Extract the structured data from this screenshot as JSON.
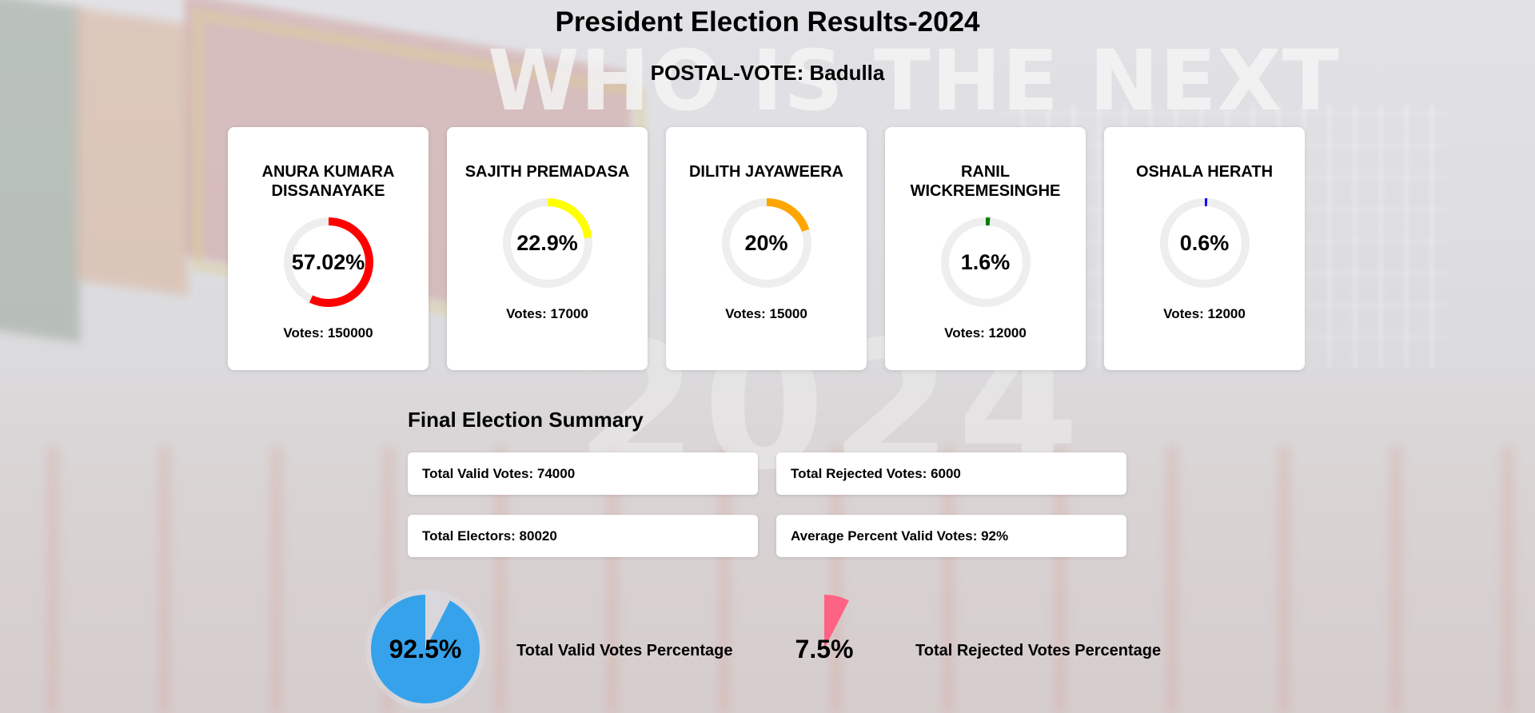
{
  "page": {
    "title": "President Election Results-2024",
    "subtitle": "POSTAL-VOTE: Badulla",
    "background_text": "WHO IS THE NEXT",
    "background_year": "2024"
  },
  "candidates": [
    {
      "name": "ANURA KUMARA DISSANAYAKE",
      "percent_label": "57.02%",
      "percent": 57.02,
      "votes_label": "Votes: 150000",
      "color": "#ff0000"
    },
    {
      "name": "SAJITH PREMADASA",
      "percent_label": "22.9%",
      "percent": 22.9,
      "votes_label": "Votes: 17000",
      "color": "#ffff00"
    },
    {
      "name": "DILITH JAYAWEERA",
      "percent_label": "20%",
      "percent": 20,
      "votes_label": "Votes: 15000",
      "color": "#ffa500"
    },
    {
      "name": "RANIL WICKREMESINGHE",
      "percent_label": "1.6%",
      "percent": 1.6,
      "votes_label": "Votes: 12000",
      "color": "#008000"
    },
    {
      "name": "OSHALA HERATH",
      "percent_label": "0.6%",
      "percent": 0.6,
      "votes_label": "Votes: 12000",
      "color": "#0000ff"
    }
  ],
  "summary": {
    "title": "Final Election Summary",
    "total_valid": "Total Valid Votes: 74000",
    "total_rejected": "Total Rejected Votes: 6000",
    "total_electors": "Total Electors: 80020",
    "average_valid": "Average Percent Valid Votes: 92%"
  },
  "pies": {
    "valid": {
      "percent_label": "92.5%",
      "percent": 92.5,
      "caption": "Total Valid Votes Percentage",
      "color": "#36a2eb"
    },
    "rejected": {
      "percent_label": "7.5%",
      "percent": 7.5,
      "caption": "Total Rejected Votes Percentage",
      "color": "#ff6384"
    }
  },
  "colors": {
    "track": "#eeeeee",
    "card_bg": "#ffffff"
  }
}
